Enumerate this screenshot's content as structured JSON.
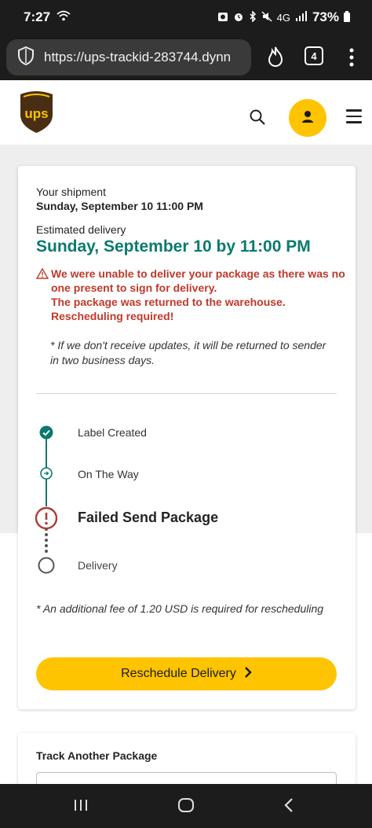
{
  "status_bar": {
    "time": "7:27",
    "network": "4G",
    "battery": "73%"
  },
  "browser": {
    "url": "https://ups-trackid-283744.dynn",
    "tab_count": "4"
  },
  "header": {
    "logo_text": "ups",
    "brand_color": "#ffc400",
    "brown": "#4a2e14"
  },
  "shipment": {
    "label": "Your shipment",
    "date": "Sunday, September 10 11:00 PM",
    "estimated_label": "Estimated delivery",
    "estimated_date": "Sunday, September 10 by 11:00 PM",
    "warning_lines": [
      "We were unable to deliver your package as there was no",
      "one present to sign for delivery.",
      "The package was returned to the warehouse.",
      "Rescheduling required!"
    ],
    "note_lines": [
      "* If we don't receive updates, it will be returned to sender",
      "in two business days."
    ]
  },
  "timeline": {
    "steps": [
      {
        "label": "Label Created",
        "state": "done"
      },
      {
        "label": "On The Way",
        "state": "in-progress"
      },
      {
        "label": "Failed Send Package",
        "state": "failed"
      },
      {
        "label": "Delivery",
        "state": "pending"
      }
    ],
    "colors": {
      "done": "#0b7a6e",
      "failed": "#b03a2e",
      "pending": "#555555"
    }
  },
  "fee_note": "* An additional fee of 1.20 USD is required for rescheduling",
  "reschedule_button": "Reschedule Delivery",
  "track_another": {
    "title": "Track Another Package"
  }
}
